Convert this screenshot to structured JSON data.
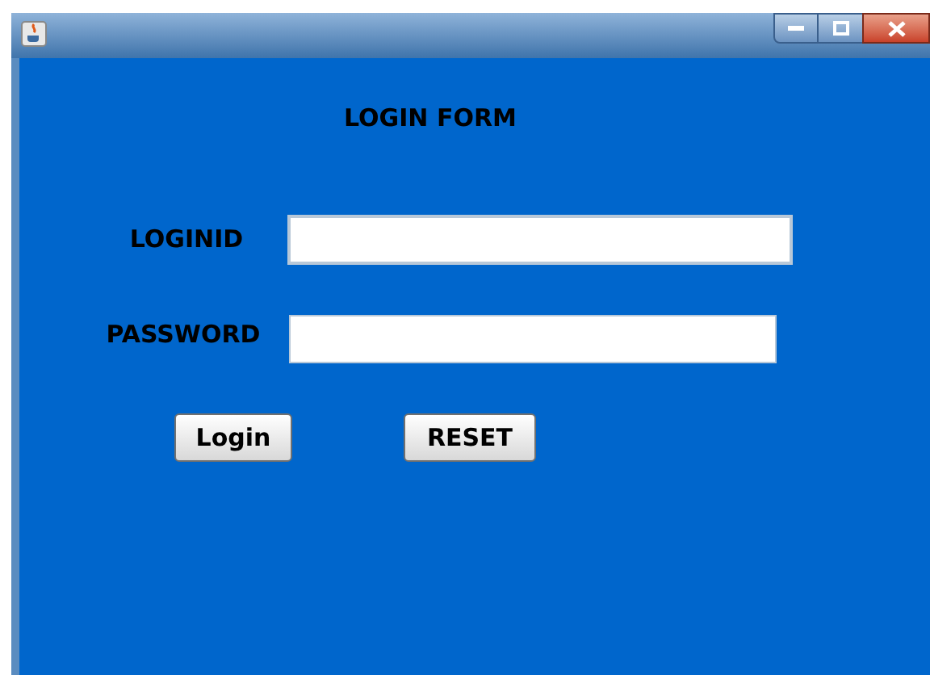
{
  "form": {
    "title": "LOGIN FORM",
    "fields": [
      {
        "label": "LOGINID"
      },
      {
        "label": "PASSWORD"
      }
    ],
    "buttons": [
      {
        "label": "Login"
      },
      {
        "label": "RESET"
      }
    ]
  }
}
